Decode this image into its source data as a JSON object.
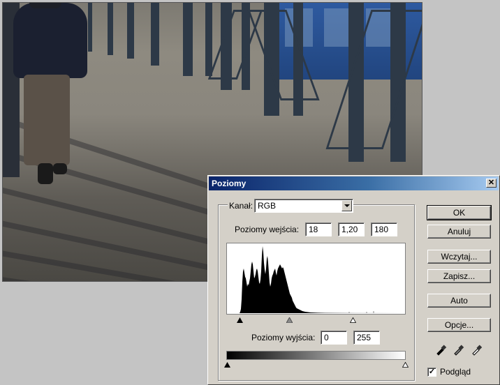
{
  "dialog": {
    "title": "Poziomy",
    "close_glyph": "✕",
    "channel": {
      "label": "Kanał:",
      "value": "RGB"
    },
    "input_levels": {
      "label": "Poziomy wejścia:",
      "black": "18",
      "gamma": "1,20",
      "white": "180"
    },
    "output_levels": {
      "label": "Poziomy wyjścia:",
      "black": "0",
      "white": "255"
    },
    "buttons": {
      "ok": "OK",
      "cancel": "Anuluj",
      "load": "Wczytaj...",
      "save": "Zapisz...",
      "auto": "Auto",
      "options": "Opcje..."
    },
    "eyedroppers": [
      "black-eyedropper-icon",
      "gray-eyedropper-icon",
      "white-eyedropper-icon"
    ],
    "preview": {
      "label": "Podgląd",
      "checked": true
    }
  },
  "colors": {
    "title_start": "#0a246a",
    "title_end": "#a6caf0",
    "dialog_bg": "#d4d0c8"
  }
}
